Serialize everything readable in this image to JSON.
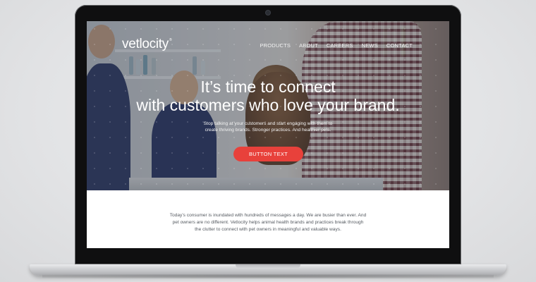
{
  "site": {
    "logo": "vetlocity",
    "logo_mark": "®",
    "nav": [
      "PRODUCTS",
      "ABOUT",
      "CAREERS",
      "NEWS",
      "CONTACT"
    ]
  },
  "hero": {
    "headline_line1": "It’s time to connect",
    "headline_line2": "with customers who love your brand.",
    "sub_line1": "Stop talking at your customers and start engaging with them to",
    "sub_line2": "create thriving brands. Stronger practices. And healthier pets.",
    "button": "BUTTON TEXT"
  },
  "body": {
    "line1": "Today’s consumer is inundated with hundreds of messages a day. We are busier than ever. And",
    "line2": "pet owners are no different. Vetlocity helps animal health brands and practices break through",
    "line3": "the clutter to connect with pet owners in meaningful and valuable ways."
  },
  "colors": {
    "cta": "#e8413b",
    "overlay": "#282e3a"
  }
}
